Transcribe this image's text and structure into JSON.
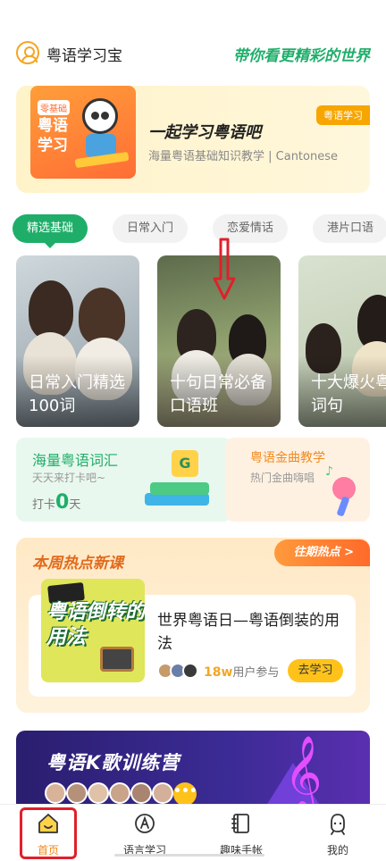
{
  "header": {
    "app_name": "粤语学习宝",
    "slogan": "带你看更精彩的世界"
  },
  "banner": {
    "image_tag": "零基础",
    "image_title": "粤语学习",
    "title": "一起学习粤语吧",
    "subtitle": "海量粤语基础知识教学 | Cantonese",
    "corner_badge": "粤语学习"
  },
  "tabs": [
    {
      "label": "精选基础",
      "active": true
    },
    {
      "label": "日常入门"
    },
    {
      "label": "恋爱情话"
    },
    {
      "label": "港片口语"
    }
  ],
  "courses": [
    {
      "label": "日常入门精选\n100词"
    },
    {
      "label": "十句日常必备\n口语班"
    },
    {
      "label": "十大爆火粤\n词句"
    }
  ],
  "vocab": {
    "title": "海量粤语词汇",
    "subtitle": "天天来打卡吧~",
    "punch_prefix": "打卡",
    "punch_count": "0",
    "punch_suffix": "天",
    "cube_letter": "G"
  },
  "music": {
    "title": "粤语金曲教学",
    "subtitle": "热门金曲嗨唱"
  },
  "hot": {
    "section_title": "本周热点新课",
    "past_button": "往期热点 >",
    "thumb_text": "粤语倒转的用法",
    "course_title": "世界粤语日—粤语倒装的用法",
    "count_value": "18w",
    "count_suffix": "用户参与",
    "learn_button": "去学习"
  },
  "karaoke": {
    "title": "粤语K歌训练营",
    "more": "•••"
  },
  "nav": [
    {
      "label": "首页",
      "icon": "home-icon",
      "active": true
    },
    {
      "label": "语言学习",
      "icon": "language-icon"
    },
    {
      "label": "趣味手帐",
      "icon": "notebook-icon"
    },
    {
      "label": "我的",
      "icon": "profile-icon"
    }
  ],
  "colors": {
    "accent_green": "#1fae6a",
    "accent_orange": "#f08a1e",
    "highlight_red": "#e0202a"
  }
}
